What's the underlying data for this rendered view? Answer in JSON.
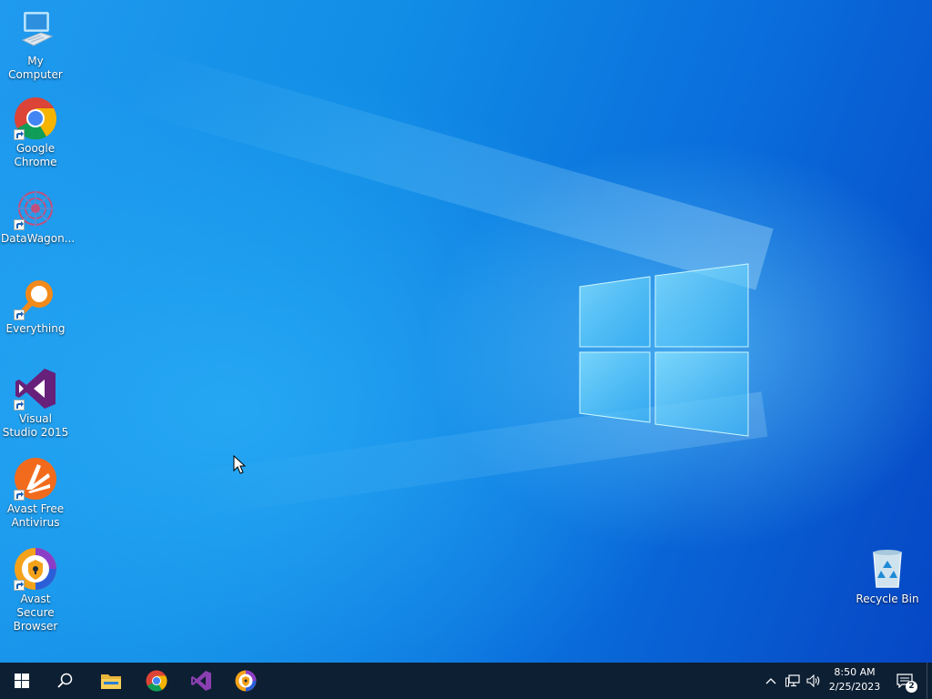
{
  "desktop": {
    "icons": [
      {
        "label": "My Computer",
        "icon": "computer-icon"
      },
      {
        "label": "Google Chrome",
        "icon": "chrome-icon"
      },
      {
        "label": "DataWagon...",
        "icon": "datawagon-icon"
      },
      {
        "label": "Everything",
        "icon": "everything-search-icon"
      },
      {
        "label": "Visual Studio 2015",
        "icon": "visual-studio-icon"
      },
      {
        "label": "Avast Free Antivirus",
        "icon": "avast-antivirus-icon"
      },
      {
        "label": "Avast Secure Browser",
        "icon": "avast-browser-icon"
      }
    ],
    "recycle_bin": {
      "label": "Recycle Bin",
      "icon": "recycle-bin-icon"
    }
  },
  "taskbar": {
    "pinned": [
      "start-icon",
      "search-icon",
      "file-explorer-icon",
      "chrome-icon",
      "visual-studio-icon",
      "avast-browser-icon"
    ],
    "tray": {
      "time": "8:50 AM",
      "date": "2/25/2023",
      "notification_count": "2"
    }
  },
  "colors": {
    "taskbar": "#0d1f33",
    "wallpaper_accent": "#0a63d6"
  }
}
